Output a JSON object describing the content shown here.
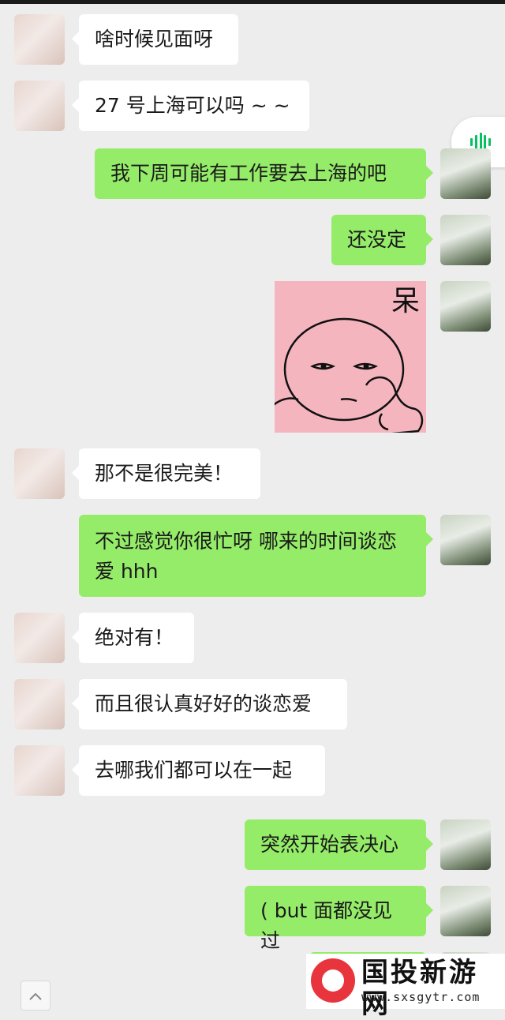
{
  "messages": [
    {
      "sender": "them",
      "text": "啥时候见面呀"
    },
    {
      "sender": "them",
      "text": "27 号上海可以吗 ~ ~"
    },
    {
      "sender": "me",
      "text": "我下周可能有工作要去上海的吧"
    },
    {
      "sender": "me",
      "text": "还没定"
    },
    {
      "sender": "me",
      "sticker_text": "呆"
    },
    {
      "sender": "them",
      "text": "那不是很完美！"
    },
    {
      "sender": "me",
      "text": "不过感觉你很忙呀 哪来的时间谈恋爱 hhh"
    },
    {
      "sender": "them",
      "text": "绝对有！"
    },
    {
      "sender": "them",
      "text": "而且很认真好好的谈恋爱"
    },
    {
      "sender": "them",
      "text": "去哪我们都可以在一起"
    },
    {
      "sender": "me",
      "text": "突然开始表决心"
    },
    {
      "sender": "me",
      "text": "( but 面都没见过"
    }
  ],
  "icons": {
    "voice": "voice-wave-icon",
    "scroll_up": "chevron-up-icon"
  },
  "colors": {
    "background": "#ededed",
    "bubble_me": "#95ec69",
    "bubble_them": "#ffffff",
    "sticker_bg": "#f5b5bf",
    "voice_accent": "#07c160",
    "watermark_logo": "#e8343c"
  },
  "watermark": {
    "title": "国投新游网",
    "domain": "www.sxsgytr.com"
  }
}
